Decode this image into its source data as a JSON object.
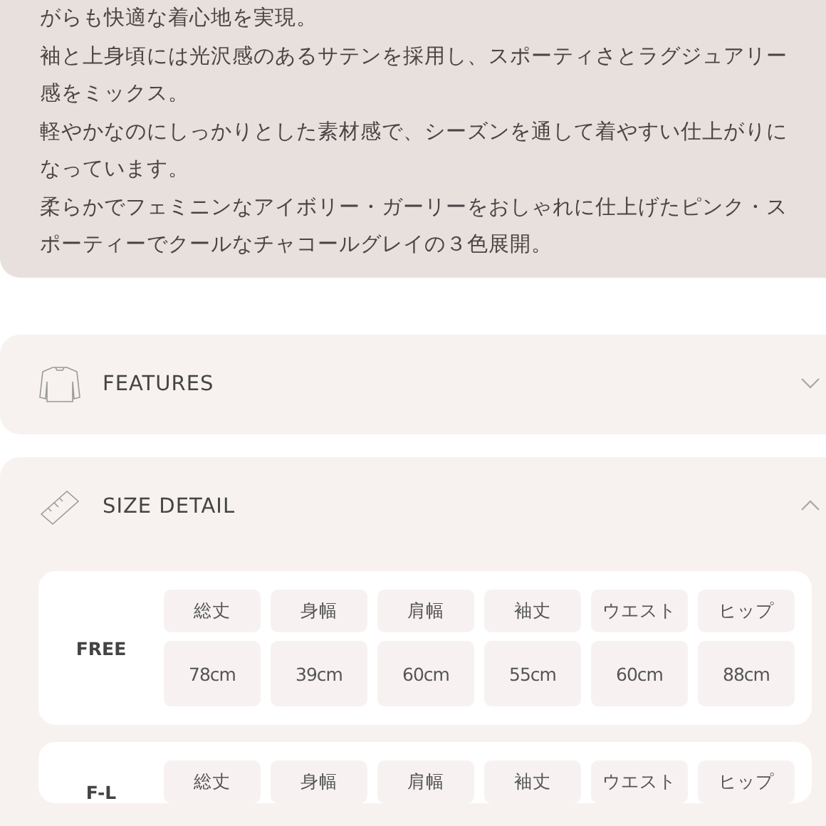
{
  "description": {
    "paragraphs": [
      "がらも快適な着心地を実現。",
      "袖と上身頃には光沢感のあるサテンを採用し、スポーティさとラグジュアリー感をミックス。",
      "軽やかなのにしっかりとした素材感で、シーズンを通して着やすい仕上がりになっています。",
      "柔らかでフェミニンなアイボリー・ガーリーをおしゃれに仕上げたピンク・スポーティーでクールなチャコールグレイの３色展開。"
    ]
  },
  "sections": [
    {
      "kind": "features",
      "title": "FEATURES",
      "expanded": false
    },
    {
      "kind": "size",
      "title": "SIZE DETAIL",
      "expanded": true,
      "sizes": [
        {
          "size": "FREE",
          "headers": [
            "総丈",
            "身幅",
            "肩幅",
            "袖丈",
            "ウエスト",
            "ヒップ"
          ],
          "values": [
            "78cm",
            "39cm",
            "60cm",
            "55cm",
            "60cm",
            "88cm"
          ]
        },
        {
          "size": "F-L",
          "headers": [
            "総丈",
            "身幅",
            "肩幅",
            "袖丈",
            "ウエスト",
            "ヒップ"
          ]
        }
      ]
    }
  ]
}
